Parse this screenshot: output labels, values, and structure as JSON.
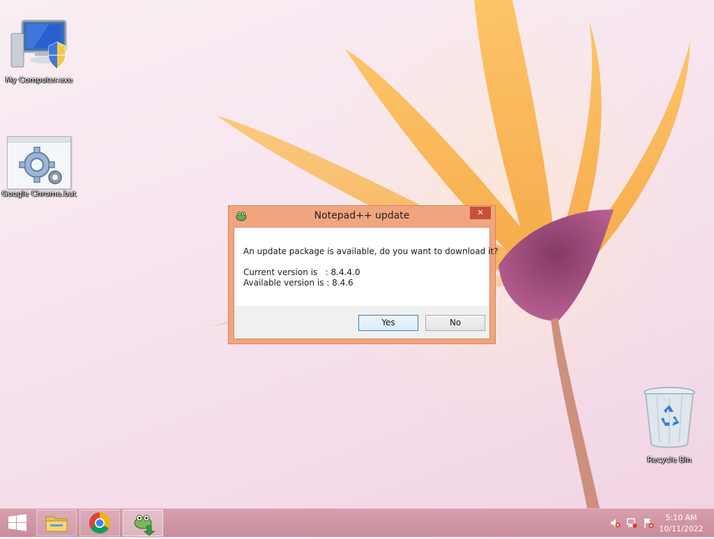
{
  "desktop": {
    "icons": [
      {
        "label": "My Computer.exe",
        "icon": "computer-shield-icon"
      },
      {
        "label": "Google Chrome.bat",
        "icon": "gear-file-icon"
      },
      {
        "label": "Recycle Bin",
        "icon": "recycle-bin-icon"
      }
    ]
  },
  "dialog": {
    "title": "Notepad++ update",
    "close_label": "✕",
    "message": "An update package is available, do you want to download it?",
    "current_version": "Current version is   : 8.4.4.0",
    "available_version": "Available version is : 8.4.6",
    "yes_label": "Yes",
    "no_label": "No"
  },
  "taskbar": {
    "start_icon": "windows-logo-icon",
    "pinned": [
      {
        "name": "File Explorer",
        "icon": "folder-icon"
      },
      {
        "name": "Google Chrome",
        "icon": "chrome-icon"
      },
      {
        "name": "Notepad++",
        "icon": "notepad-plus-plus-icon",
        "active": true
      }
    ],
    "tray": [
      "volume-muted-icon",
      "network-icon",
      "action-center-flag-icon"
    ],
    "clock": {
      "time": "5:10 AM",
      "date": "10/11/2022"
    }
  },
  "colors": {
    "dialog_frame": "#f0a57e",
    "close_button": "#c84f3b",
    "taskbar": "#d29aa9",
    "default_button_border": "#3c7fb1"
  }
}
